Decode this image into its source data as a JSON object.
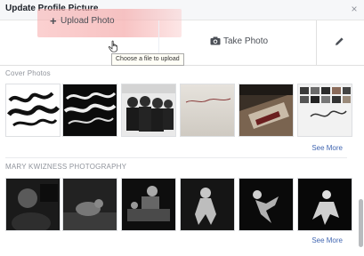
{
  "dialog": {
    "title": "Update Profile Picture",
    "close_symbol": "×"
  },
  "actions": {
    "upload_plus": "+",
    "upload_label": "Upload Photo",
    "upload_tooltip": "Choose a file to upload",
    "take_photo_label": "Take Photo",
    "camera_icon": "camera-icon",
    "edit_icon": "pencil-icon"
  },
  "sections": [
    {
      "title": "Cover Photos",
      "see_more": "See More",
      "thumbs": [
        "cover-1",
        "cover-2",
        "cover-3",
        "cover-4",
        "cover-5",
        "cover-6"
      ]
    },
    {
      "title": "MARY KWIZNESS PHOTOGRAPHY",
      "see_more": "See More",
      "thumbs": [
        "mk-1",
        "mk-2",
        "mk-3",
        "mk-4",
        "mk-5",
        "mk-6"
      ]
    }
  ],
  "colors": {
    "link": "#4267b2",
    "upload_highlight": "#f5aaaa",
    "muted": "#90949c"
  }
}
